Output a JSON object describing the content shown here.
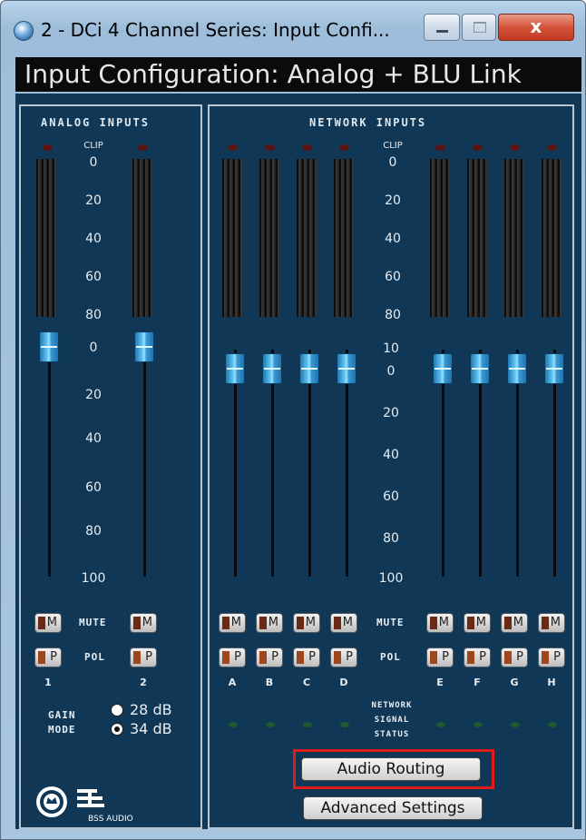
{
  "window": {
    "title": "2 - DCi 4 Channel Series: Input Confi...",
    "close_label": "x"
  },
  "header": {
    "title": "Input Configuration: Analog + BLU Link"
  },
  "analog": {
    "title": "ANALOG INPUTS",
    "clip": "CLIP",
    "meter_scale": [
      "0",
      "20",
      "40",
      "60",
      "80"
    ],
    "fader_scale": [
      "0",
      "20",
      "40",
      "60",
      "80",
      "100"
    ],
    "mute_label": "MUTE",
    "pol_label": "POL",
    "channels": [
      "1",
      "2"
    ],
    "gain": {
      "label1": "GAIN",
      "label2": "MODE",
      "options": [
        "28 dB",
        "34 dB"
      ],
      "selected": "34 dB"
    }
  },
  "network": {
    "title": "NETWORK INPUTS",
    "clip": "CLIP",
    "meter_scale": [
      "0",
      "20",
      "40",
      "60",
      "80"
    ],
    "fader_scale": [
      "10",
      "0",
      "20",
      "40",
      "60",
      "80",
      "100"
    ],
    "mute_label": "MUTE",
    "pol_label": "POL",
    "channels": [
      "A",
      "B",
      "C",
      "D",
      "E",
      "F",
      "G",
      "H"
    ],
    "signal_status": [
      "NETWORK",
      "SIGNAL",
      "STATUS"
    ]
  },
  "buttons": {
    "mute": "M",
    "pol": "P",
    "audio_routing": "Audio Routing",
    "advanced": "Advanced Settings"
  },
  "logo": {
    "text": "BSS AUDIO"
  }
}
